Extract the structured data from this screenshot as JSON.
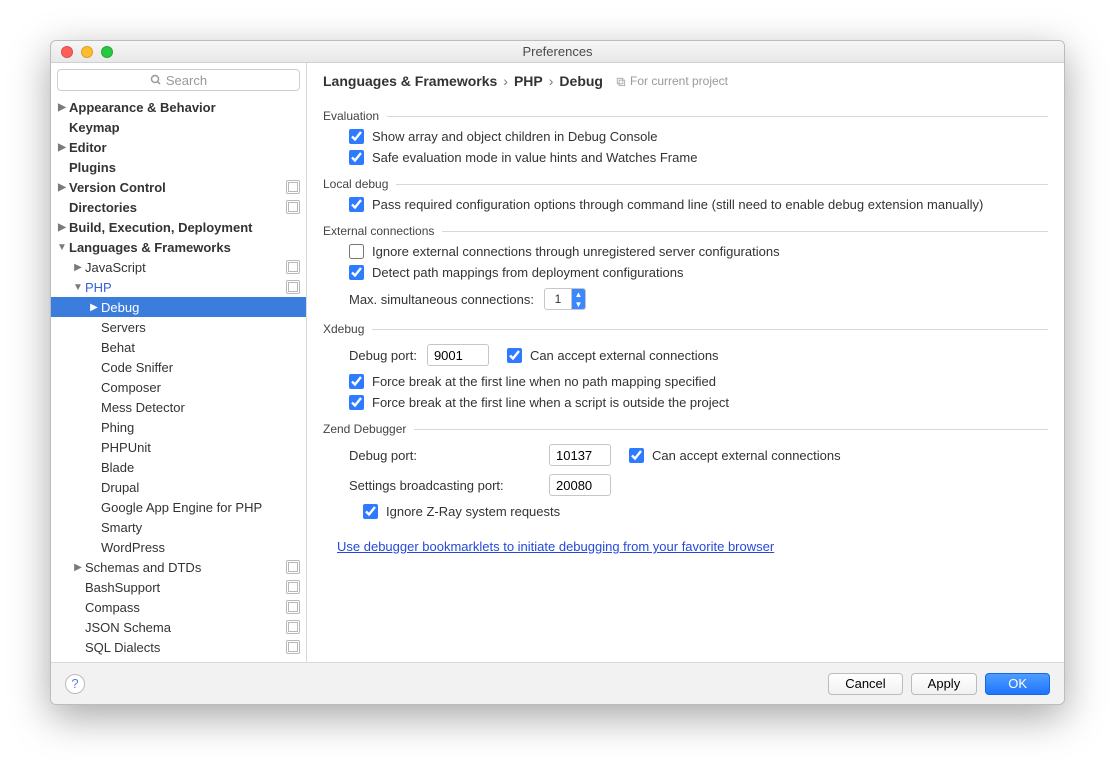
{
  "window": {
    "title": "Preferences"
  },
  "search": {
    "placeholder": "Search"
  },
  "breadcrumb": [
    "Languages & Frameworks",
    "PHP",
    "Debug"
  ],
  "breadcrumb_hint": "For current project",
  "tree": [
    {
      "label": "Appearance & Behavior",
      "depth": 0,
      "arrow": "right",
      "bold": true
    },
    {
      "label": "Keymap",
      "depth": 0,
      "bold": true
    },
    {
      "label": "Editor",
      "depth": 0,
      "arrow": "right",
      "bold": true
    },
    {
      "label": "Plugins",
      "depth": 0,
      "bold": true
    },
    {
      "label": "Version Control",
      "depth": 0,
      "arrow": "right",
      "bold": true,
      "badge": true
    },
    {
      "label": "Directories",
      "depth": 0,
      "bold": true,
      "badge": true
    },
    {
      "label": "Build, Execution, Deployment",
      "depth": 0,
      "arrow": "right",
      "bold": true
    },
    {
      "label": "Languages & Frameworks",
      "depth": 0,
      "arrow": "down",
      "bold": true
    },
    {
      "label": "JavaScript",
      "depth": 1,
      "arrow": "right",
      "badge": true
    },
    {
      "label": "PHP",
      "depth": 1,
      "arrow": "down",
      "badge": true,
      "blue": true
    },
    {
      "label": "Debug",
      "depth": 2,
      "arrow": "right",
      "selected": true
    },
    {
      "label": "Servers",
      "depth": 2
    },
    {
      "label": "Behat",
      "depth": 2
    },
    {
      "label": "Code Sniffer",
      "depth": 2
    },
    {
      "label": "Composer",
      "depth": 2
    },
    {
      "label": "Mess Detector",
      "depth": 2
    },
    {
      "label": "Phing",
      "depth": 2
    },
    {
      "label": "PHPUnit",
      "depth": 2
    },
    {
      "label": "Blade",
      "depth": 2
    },
    {
      "label": "Drupal",
      "depth": 2
    },
    {
      "label": "Google App Engine for PHP",
      "depth": 2
    },
    {
      "label": "Smarty",
      "depth": 2
    },
    {
      "label": "WordPress",
      "depth": 2
    },
    {
      "label": "Schemas and DTDs",
      "depth": 1,
      "arrow": "right",
      "badge": true
    },
    {
      "label": "BashSupport",
      "depth": 1,
      "badge": true
    },
    {
      "label": "Compass",
      "depth": 1,
      "badge": true
    },
    {
      "label": "JSON Schema",
      "depth": 1,
      "badge": true
    },
    {
      "label": "SQL Dialects",
      "depth": 1,
      "badge": true
    }
  ],
  "sections": {
    "evaluation": {
      "title": "Evaluation",
      "opt1": "Show array and object children in Debug Console",
      "opt2": "Safe evaluation mode in value hints and Watches Frame"
    },
    "local": {
      "title": "Local debug",
      "opt1": "Pass required configuration options through command line (still need to enable debug extension manually)"
    },
    "external": {
      "title": "External connections",
      "opt1": "Ignore external connections through unregistered server configurations",
      "opt2": "Detect path mappings from deployment configurations",
      "max_conn_label": "Max. simultaneous connections:",
      "max_conn_value": "1"
    },
    "xdebug": {
      "title": "Xdebug",
      "port_label": "Debug port:",
      "port_value": "9001",
      "accept_label": "Can accept external connections",
      "opt1": "Force break at the first line when no path mapping specified",
      "opt2": "Force break at the first line when a script is outside the project"
    },
    "zend": {
      "title": "Zend Debugger",
      "port_label": "Debug port:",
      "port_value": "10137",
      "accept_label": "Can accept external connections",
      "broadcast_label": "Settings broadcasting port:",
      "broadcast_value": "20080",
      "zray": "Ignore Z-Ray system requests"
    }
  },
  "link_text": "Use debugger bookmarklets to initiate debugging from your favorite browser",
  "buttons": {
    "cancel": "Cancel",
    "apply": "Apply",
    "ok": "OK"
  }
}
